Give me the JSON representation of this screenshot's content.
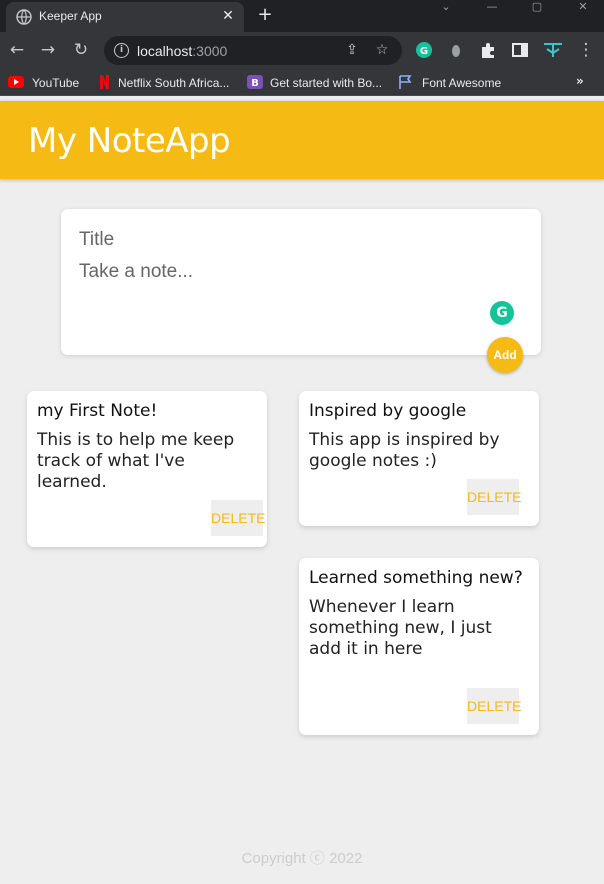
{
  "browser": {
    "tab_title": "Keeper App",
    "url_host": "localhost",
    "url_port": ":3000",
    "bookmarks": [
      {
        "label": "YouTube",
        "icon": "youtube-icon"
      },
      {
        "label": "Netflix South Africa...",
        "icon": "netflix-icon"
      },
      {
        "label": "Get started with Bo...",
        "icon": "bootstrap-icon"
      },
      {
        "label": "Font Awesome",
        "icon": "flag-icon"
      }
    ],
    "more_bookmarks": "»"
  },
  "app": {
    "title": "My NoteApp",
    "accent_color": "#f5ba13"
  },
  "create": {
    "title_placeholder": "Title",
    "content_placeholder": "Take a note...",
    "add_label": "Add"
  },
  "notes": [
    {
      "title": "my First Note!",
      "content": "This is to help me keep track of what I've learned.",
      "delete_label": "DELETE"
    },
    {
      "title": "Inspired by google",
      "content": "This app is inspired by google notes :)",
      "delete_label": "DELETE"
    },
    {
      "title": "Learned something new?",
      "content": "Whenever I learn something new, I just add it in here",
      "delete_label": "DELETE"
    }
  ],
  "footer": {
    "copyright": "Copyright ⓒ 2022"
  }
}
